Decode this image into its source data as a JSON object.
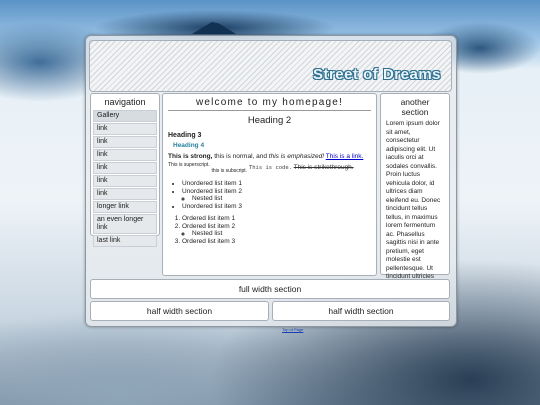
{
  "header": {
    "title": "Street of Dreams"
  },
  "nav": {
    "title": "navigation",
    "items": [
      {
        "label": "Gallery"
      },
      {
        "label": "link"
      },
      {
        "label": "link"
      },
      {
        "label": "link"
      },
      {
        "label": "link"
      },
      {
        "label": "link"
      },
      {
        "label": "link"
      },
      {
        "label": "longer link"
      },
      {
        "label": "an even longer link"
      },
      {
        "label": "last link"
      }
    ]
  },
  "main": {
    "title": "welcome to my homepage!",
    "heading2": "Heading 2",
    "heading3": "Heading 3",
    "heading4": "Heading 4",
    "strong": "This is strong,",
    "normal": " this is normal, and ",
    "emph": "this is emphasized!",
    "link": "This is a link.",
    "superscript": "This is superscript.",
    "subscript": "this is subscript.",
    "code": "This is code.",
    "strike": "This is strikethrough.",
    "ul": [
      "Unordered list item 1",
      "Unordered list item 2",
      "Nested list",
      "Unordered list item 3"
    ],
    "ol": [
      "Ordered list item 1",
      "Ordered list item 2",
      "Nested list",
      "Ordered list item 3"
    ]
  },
  "side": {
    "title": "another section",
    "text": "Lorem ipsum dolor sit amet, consectetur adipiscing elit. Ut iaculis orci at sodales convallis. Proin luctus vehicula dolor, id ultrices diam eleifend eu. Donec tincidunt tellus tellus, in maximus lorem fermentum ac. Phasellus sagittis nisi in ante pretium, eget molestie est pellentesque. Ut tincidunt ultricies porta."
  },
  "footer": {
    "full": "full width section",
    "half_left": "half width section",
    "half_right": "half width section",
    "mini_link": "Top of Page"
  },
  "colors": {
    "heading4": "#27809f",
    "link": "#0000cc",
    "title_outline": "#2f6f8f"
  }
}
